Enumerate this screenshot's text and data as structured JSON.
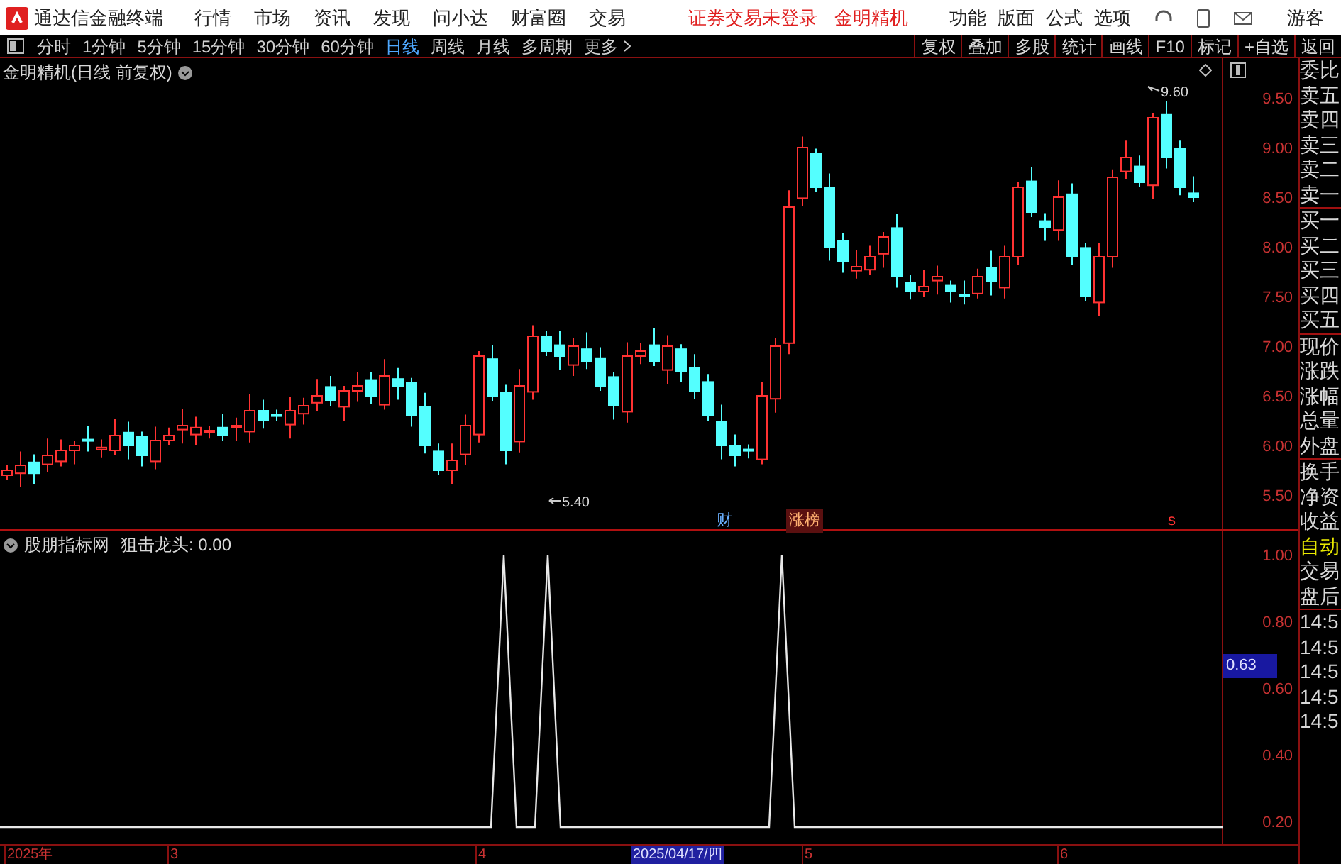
{
  "title_bar": {
    "app_name": "通达信金融终端",
    "menu": [
      "行情",
      "市场",
      "资讯",
      "发现",
      "问小达",
      "财富圈",
      "交易"
    ],
    "notice": "证券交易未登录",
    "stock": "金明精机",
    "tools": [
      "功能",
      "版面",
      "公式",
      "选项"
    ],
    "user": "游客"
  },
  "period_tabs": [
    {
      "label": "分时",
      "selected": false
    },
    {
      "label": "1分钟",
      "selected": false
    },
    {
      "label": "5分钟",
      "selected": false
    },
    {
      "label": "15分钟",
      "selected": false
    },
    {
      "label": "30分钟",
      "selected": false
    },
    {
      "label": "60分钟",
      "selected": false
    },
    {
      "label": "日线",
      "selected": true
    },
    {
      "label": "周线",
      "selected": false
    },
    {
      "label": "月线",
      "selected": false
    },
    {
      "label": "多周期",
      "selected": false
    },
    {
      "label": "更多",
      "selected": false
    }
  ],
  "action_buttons": [
    "复权",
    "叠加",
    "多股",
    "统计",
    "画线",
    "F10",
    "标记",
    "+自选",
    "返回"
  ],
  "main_chart": {
    "title": "金明精机(日线 前复权)",
    "yticks": [
      "9.50",
      "9.00",
      "8.50",
      "8.00",
      "7.50",
      "7.00",
      "6.50",
      "6.00",
      "5.50"
    ],
    "high_label": "9.60",
    "low_label": "5.40",
    "markers": [
      {
        "kind": "text",
        "label": "财"
      },
      {
        "kind": "badge",
        "label": "涨榜"
      },
      {
        "kind": "flag",
        "label": "s"
      }
    ]
  },
  "indicator": {
    "title": "股朋指标网",
    "value": "狙击龙头: 0.00",
    "yticks": [
      "1.00",
      "0.80",
      "0.60",
      "0.40",
      "0.20"
    ],
    "cursor_value": "0.63"
  },
  "date_axis": [
    {
      "label": "2025年",
      "selected": false
    },
    {
      "label": "3",
      "selected": false
    },
    {
      "label": "4",
      "selected": false
    },
    {
      "label": "2025/04/17/四",
      "selected": true
    },
    {
      "label": "5",
      "selected": false
    },
    {
      "label": "6",
      "selected": false
    }
  ],
  "side_panel": [
    {
      "label": "委比",
      "kind": "plain"
    },
    {
      "label": "卖五",
      "kind": "plain"
    },
    {
      "label": "卖四",
      "kind": "plain"
    },
    {
      "label": "卖三",
      "kind": "plain"
    },
    {
      "label": "卖二",
      "kind": "plain"
    },
    {
      "label": "卖一",
      "kind": "plain"
    },
    {
      "label": "买一",
      "kind": "divided"
    },
    {
      "label": "买二",
      "kind": "plain"
    },
    {
      "label": "买三",
      "kind": "plain"
    },
    {
      "label": "买四",
      "kind": "plain"
    },
    {
      "label": "买五",
      "kind": "plain"
    },
    {
      "label": "现价",
      "kind": "divided"
    },
    {
      "label": "涨跌",
      "kind": "plain"
    },
    {
      "label": "涨幅",
      "kind": "plain"
    },
    {
      "label": "总量",
      "kind": "plain"
    },
    {
      "label": "外盘",
      "kind": "plain"
    },
    {
      "label": "换手",
      "kind": "divided"
    },
    {
      "label": "净资",
      "kind": "plain"
    },
    {
      "label": "收益",
      "kind": "plain"
    },
    {
      "label": "自动",
      "kind": "highlight"
    },
    {
      "label": "交易",
      "kind": "plain"
    },
    {
      "label": "盘后",
      "kind": "plain"
    },
    {
      "label": "14:5",
      "kind": "divided"
    },
    {
      "label": "14:5",
      "kind": "plain"
    },
    {
      "label": "14:5",
      "kind": "plain"
    },
    {
      "label": "14:5",
      "kind": "plain"
    },
    {
      "label": "14:5",
      "kind": "plain"
    }
  ]
}
